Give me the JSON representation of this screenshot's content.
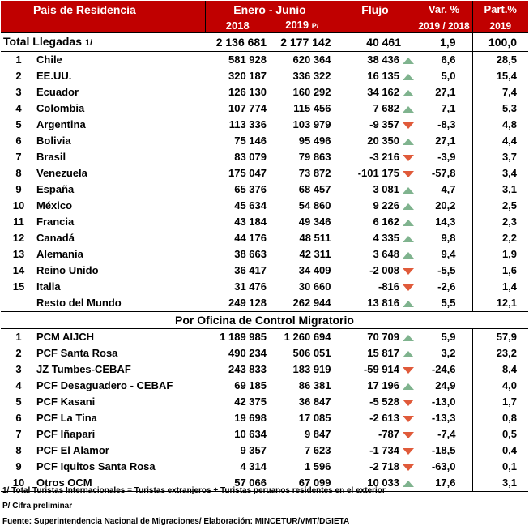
{
  "headers": {
    "country": "País de Residencia",
    "period": "Enero - Junio",
    "y2018": "2018",
    "y2019": "2019",
    "y2019_suffix": "P/",
    "flow": "Flujo",
    "var_title": "Var. %",
    "var_sub": "2019 / 2018",
    "part_title": "Part.%",
    "part_sub": "2019"
  },
  "total": {
    "label": "Total Llegadas",
    "note": "1/",
    "y2018": "2 136 681",
    "y2019": "2 177 142",
    "flow": "40 461",
    "var": "1,9",
    "part": "100,0"
  },
  "countries": [
    {
      "idx": "1",
      "name": "Chile",
      "y2018": "581 928",
      "y2019": "620 364",
      "flow": "38 436",
      "dir": "up",
      "var": "6,6",
      "part": "28,5"
    },
    {
      "idx": "2",
      "name": "EE.UU.",
      "y2018": "320 187",
      "y2019": "336 322",
      "flow": "16 135",
      "dir": "up",
      "var": "5,0",
      "part": "15,4"
    },
    {
      "idx": "3",
      "name": "Ecuador",
      "y2018": "126 130",
      "y2019": "160 292",
      "flow": "34 162",
      "dir": "up",
      "var": "27,1",
      "part": "7,4"
    },
    {
      "idx": "4",
      "name": "Colombia",
      "y2018": "107 774",
      "y2019": "115 456",
      "flow": "7 682",
      "dir": "up",
      "var": "7,1",
      "part": "5,3"
    },
    {
      "idx": "5",
      "name": "Argentina",
      "y2018": "113 336",
      "y2019": "103 979",
      "flow": "-9 357",
      "dir": "down",
      "var": "-8,3",
      "part": "4,8"
    },
    {
      "idx": "6",
      "name": "Bolivia",
      "y2018": "75 146",
      "y2019": "95 496",
      "flow": "20 350",
      "dir": "up",
      "var": "27,1",
      "part": "4,4"
    },
    {
      "idx": "7",
      "name": "Brasil",
      "y2018": "83 079",
      "y2019": "79 863",
      "flow": "-3 216",
      "dir": "down",
      "var": "-3,9",
      "part": "3,7"
    },
    {
      "idx": "8",
      "name": "Venezuela",
      "y2018": "175 047",
      "y2019": "73 872",
      "flow": "-101 175",
      "dir": "down",
      "var": "-57,8",
      "part": "3,4"
    },
    {
      "idx": "9",
      "name": "España",
      "y2018": "65 376",
      "y2019": "68 457",
      "flow": "3 081",
      "dir": "up",
      "var": "4,7",
      "part": "3,1"
    },
    {
      "idx": "10",
      "name": "México",
      "y2018": "45 634",
      "y2019": "54 860",
      "flow": "9 226",
      "dir": "up",
      "var": "20,2",
      "part": "2,5"
    },
    {
      "idx": "11",
      "name": "Francia",
      "y2018": "43 184",
      "y2019": "49 346",
      "flow": "6 162",
      "dir": "up",
      "var": "14,3",
      "part": "2,3"
    },
    {
      "idx": "12",
      "name": "Canadá",
      "y2018": "44 176",
      "y2019": "48 511",
      "flow": "4 335",
      "dir": "up",
      "var": "9,8",
      "part": "2,2"
    },
    {
      "idx": "13",
      "name": "Alemania",
      "y2018": "38 663",
      "y2019": "42 311",
      "flow": "3 648",
      "dir": "up",
      "var": "9,4",
      "part": "1,9"
    },
    {
      "idx": "14",
      "name": "Reino Unido",
      "y2018": "36 417",
      "y2019": "34 409",
      "flow": "-2 008",
      "dir": "down",
      "var": "-5,5",
      "part": "1,6"
    },
    {
      "idx": "15",
      "name": "Italia",
      "y2018": "31 476",
      "y2019": "30 660",
      "flow": "-816",
      "dir": "down",
      "var": "-2,6",
      "part": "1,4"
    },
    {
      "idx": "",
      "name": "Resto del Mundo",
      "y2018": "249 128",
      "y2019": "262 944",
      "flow": "13 816",
      "dir": "up",
      "var": "5,5",
      "part": "12,1"
    }
  ],
  "section_title": "Por Oficina de Control Migratorio",
  "offices": [
    {
      "idx": "1",
      "name": "PCM AIJCH",
      "y2018": "1 189 985",
      "y2019": "1 260 694",
      "flow": "70 709",
      "dir": "up",
      "var": "5,9",
      "part": "57,9"
    },
    {
      "idx": "2",
      "name": "PCF Santa Rosa",
      "y2018": "490 234",
      "y2019": "506 051",
      "flow": "15 817",
      "dir": "up",
      "var": "3,2",
      "part": "23,2"
    },
    {
      "idx": "3",
      "name": "JZ Tumbes-CEBAF",
      "y2018": "243 833",
      "y2019": "183 919",
      "flow": "-59 914",
      "dir": "down",
      "var": "-24,6",
      "part": "8,4"
    },
    {
      "idx": "4",
      "name": "PCF Desaguadero - CEBAF",
      "y2018": "69 185",
      "y2019": "86 381",
      "flow": "17 196",
      "dir": "up",
      "var": "24,9",
      "part": "4,0"
    },
    {
      "idx": "5",
      "name": "PCF Kasani",
      "y2018": "42 375",
      "y2019": "36 847",
      "flow": "-5 528",
      "dir": "down",
      "var": "-13,0",
      "part": "1,7"
    },
    {
      "idx": "6",
      "name": "PCF La Tina",
      "y2018": "19 698",
      "y2019": "17 085",
      "flow": "-2 613",
      "dir": "down",
      "var": "-13,3",
      "part": "0,8"
    },
    {
      "idx": "7",
      "name": "PCF Iñapari",
      "y2018": "10 634",
      "y2019": "9 847",
      "flow": "-787",
      "dir": "down",
      "var": "-7,4",
      "part": "0,5"
    },
    {
      "idx": "8",
      "name": "PCF El Alamor",
      "y2018": "9 357",
      "y2019": "7 623",
      "flow": "-1 734",
      "dir": "down",
      "var": "-18,5",
      "part": "0,4"
    },
    {
      "idx": "9",
      "name": "PCF Iquitos Santa Rosa",
      "y2018": "4 314",
      "y2019": "1 596",
      "flow": "-2 718",
      "dir": "down",
      "var": "-63,0",
      "part": "0,1"
    },
    {
      "idx": "10",
      "name": "Otros OCM",
      "y2018": "57 066",
      "y2019": "67 099",
      "flow": "10 033",
      "dir": "up",
      "var": "17,6",
      "part": "3,1"
    }
  ],
  "notes": {
    "note1": "1/  Total Turistas Internacionales = Turistas extranjeros + Turistas peruanos residentes en el exterior",
    "note2": "P/ Cifra preliminar",
    "source": "Fuente: Superintendencia Nacional de Migraciones/ Elaboración: MINCETUR/VMT/DGIETA"
  },
  "colors": {
    "header_bg": "#c00000",
    "up_arrow": "#7fb38e",
    "down_arrow": "#e05a3a"
  }
}
